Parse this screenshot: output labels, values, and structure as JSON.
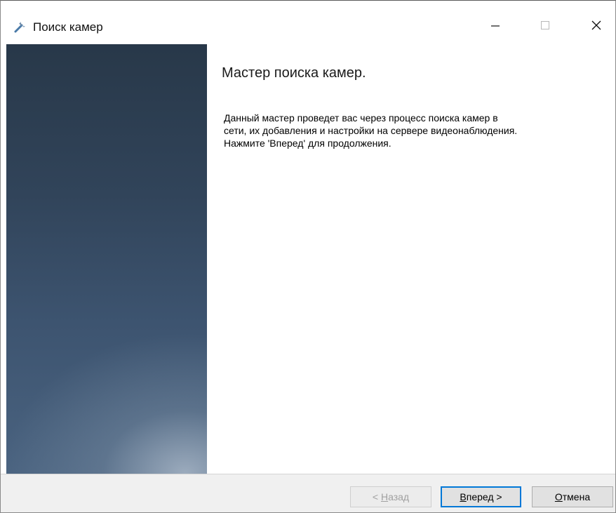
{
  "window": {
    "title": "Поиск камер",
    "app_icon": "wrench-icon",
    "controls": {
      "minimize_icon": "minimize-icon",
      "maximize_icon": "maximize-icon",
      "close_icon": "close-icon"
    }
  },
  "wizard": {
    "heading": "Мастер поиска камер.",
    "description_lines": [
      "Данный мастер проведет вас через процесс поиска камер в",
      "сети, их добавления и настройки на сервере видеонаблюдения.",
      "Нажмите 'Вперед' для продолжения."
    ]
  },
  "buttons": {
    "back": {
      "prefix": "< ",
      "accel": "Н",
      "rest": "азад",
      "enabled": false
    },
    "next": {
      "accel": "В",
      "rest": "перед >",
      "enabled": true,
      "default": true
    },
    "cancel": {
      "accel": "О",
      "rest": "тмена",
      "enabled": true
    }
  },
  "colors": {
    "accent": "#0078d7",
    "side_panel_top": "#283849",
    "side_panel_bottom": "#4a6380"
  }
}
